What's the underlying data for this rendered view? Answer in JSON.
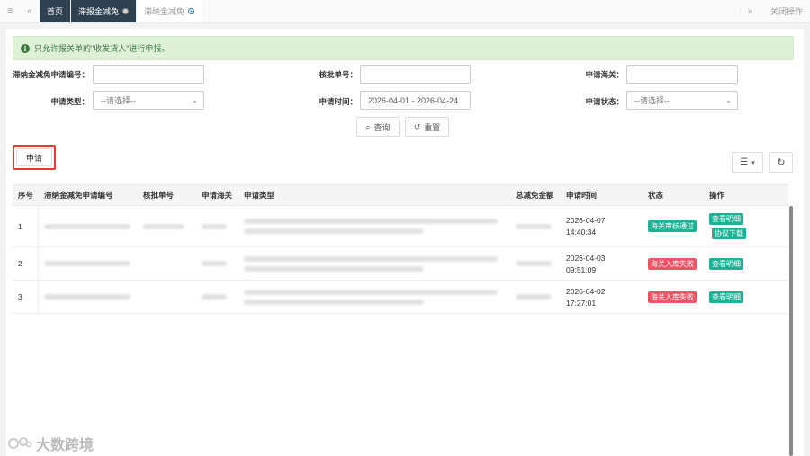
{
  "tabbar": {
    "tabs": [
      {
        "label": "首页",
        "style": "dark"
      },
      {
        "label": "滞报金减免",
        "style": "dark"
      },
      {
        "label": "滞纳金减免",
        "style": "active"
      }
    ],
    "close_ops": "关闭操作"
  },
  "alert": {
    "text": "只允许报关单的\"收发货人\"进行申报。"
  },
  "form": {
    "apply_no_label": "滞纳金减免申请编号：",
    "approval_no_label": "核批单号：",
    "customs_label": "申请海关：",
    "type_label": "申请类型：",
    "type_value": "--请选择--",
    "time_label": "申请时间：",
    "time_value": "2026-04-01 - 2026-04-24",
    "status_label": "申请状态：",
    "status_value": "--请选择--",
    "query_label": "查询",
    "reset_label": "重置"
  },
  "toolbar": {
    "apply_label": "申请"
  },
  "table": {
    "headers": [
      "序号",
      "滞纳金减免申请编号",
      "核批单号",
      "申请海关",
      "申请类型",
      "总减免金额",
      "申请时间",
      "状态",
      "操作"
    ],
    "rows": [
      {
        "no": "1",
        "time": "2026-04-07",
        "time2": "14:40:34",
        "status": "海关审核通过",
        "status_color": "green",
        "actions": [
          "查看明细",
          "协议下载"
        ]
      },
      {
        "no": "2",
        "time": "2026-04-03",
        "time2": "09:51:09",
        "status": "海关入库失败",
        "status_color": "red",
        "actions": [
          "查看明细"
        ]
      },
      {
        "no": "3",
        "time": "2026-04-02",
        "time2": "17:27:01",
        "status": "海关入库失败",
        "status_color": "red",
        "actions": [
          "查看明细"
        ]
      }
    ]
  },
  "watermark": {
    "text": "大数跨境"
  },
  "colors": {
    "green": "#1ab394",
    "red": "#ed5565",
    "nav_dark": "#2f4050",
    "alert_bg": "#dff0d8"
  }
}
